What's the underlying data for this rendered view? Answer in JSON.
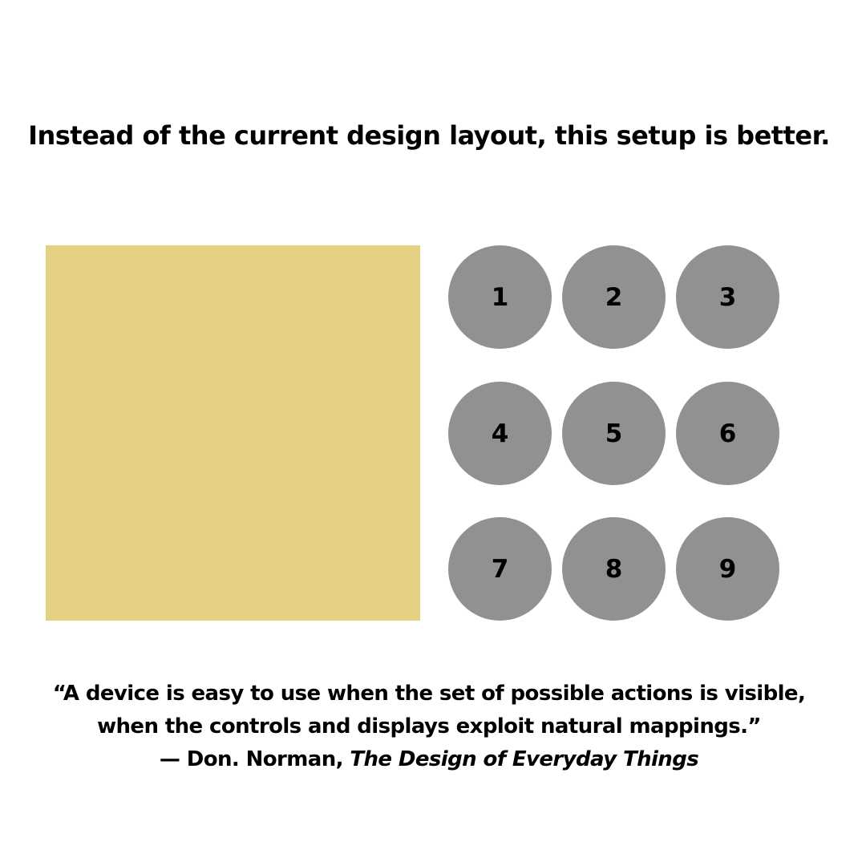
{
  "headline": "Instead of the current design layout, this setup is better.",
  "display_panel": {
    "color": "#E6D183"
  },
  "keypad": {
    "button_color": "#919191",
    "keys": [
      "1",
      "2",
      "3",
      "4",
      "5",
      "6",
      "7",
      "8",
      "9"
    ]
  },
  "quote": {
    "line1": "“A device is easy to use when the set of possible actions is visible,",
    "line2": "when the controls and displays exploit natural mappings.”",
    "attribution_prefix": "— Don. Norman, ",
    "book_title": "The Design of Everyday Things"
  }
}
